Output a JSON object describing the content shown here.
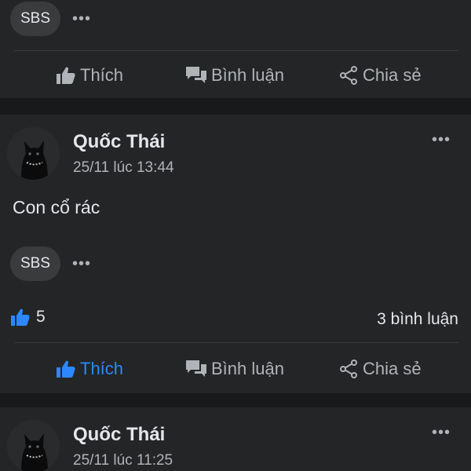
{
  "top_post": {
    "page_chip": "SBS",
    "more": "•••",
    "actions": {
      "like": "Thích",
      "comment": "Bình luận",
      "share": "Chia sẻ"
    }
  },
  "middle_post": {
    "author": "Quốc Thái",
    "timestamp": "25/11 lúc 13:44",
    "more": "•••",
    "text": "Con cổ rác",
    "page_chip": "SBS",
    "chip_more": "•••",
    "like_count": "5",
    "comment_count": "3 bình luận",
    "actions": {
      "like": "Thích",
      "comment": "Bình luận",
      "share": "Chia sẻ"
    },
    "like_active_color": "#2d88ff"
  },
  "bottom_post": {
    "author": "Quốc Thái",
    "timestamp": "25/11 lúc 11:25",
    "more": "•••"
  },
  "icons": {
    "like": "thumbs-up-icon",
    "comment": "comment-bubble-icon",
    "share": "share-icon",
    "more": "more-dots-icon",
    "avatar": "black-cat-avatar"
  }
}
